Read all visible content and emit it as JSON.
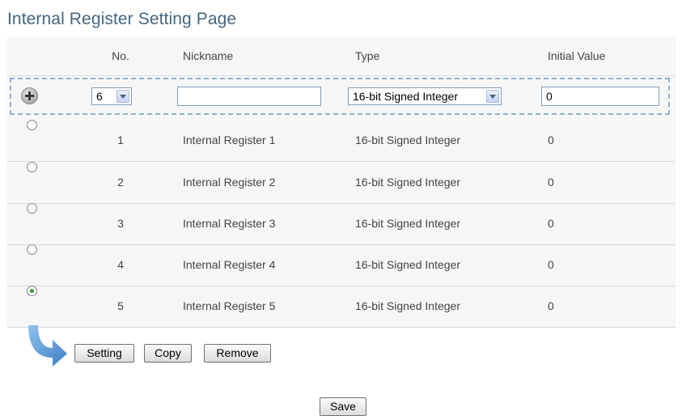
{
  "page": {
    "title": "Internal Register Setting Page"
  },
  "table": {
    "headers": {
      "no": "No.",
      "nickname": "Nickname",
      "type": "Type",
      "initial_value": "Initial Value"
    },
    "new_row": {
      "no_selected": "6",
      "nickname_value": "",
      "type_selected": "16-bit Signed Integer",
      "initial_value": "0"
    },
    "rows": [
      {
        "no": "1",
        "nickname": "Internal Register 1",
        "type": "16-bit Signed Integer",
        "initial_value": "0",
        "selected": false
      },
      {
        "no": "2",
        "nickname": "Internal Register 2",
        "type": "16-bit Signed Integer",
        "initial_value": "0",
        "selected": false
      },
      {
        "no": "3",
        "nickname": "Internal Register 3",
        "type": "16-bit Signed Integer",
        "initial_value": "0",
        "selected": false
      },
      {
        "no": "4",
        "nickname": "Internal Register 4",
        "type": "16-bit Signed Integer",
        "initial_value": "0",
        "selected": false
      },
      {
        "no": "5",
        "nickname": "Internal Register 5",
        "type": "16-bit Signed Integer",
        "initial_value": "0",
        "selected": true
      }
    ]
  },
  "actions": {
    "setting": "Setting",
    "copy": "Copy",
    "remove": "Remove",
    "save": "Save"
  },
  "colors": {
    "title": "#44657f",
    "panel_bg": "#f6f6f6",
    "add_row_border": "#8fb1d6",
    "arrow_blue": "#5b95cf",
    "radio_checked": "#3b9a3b"
  }
}
